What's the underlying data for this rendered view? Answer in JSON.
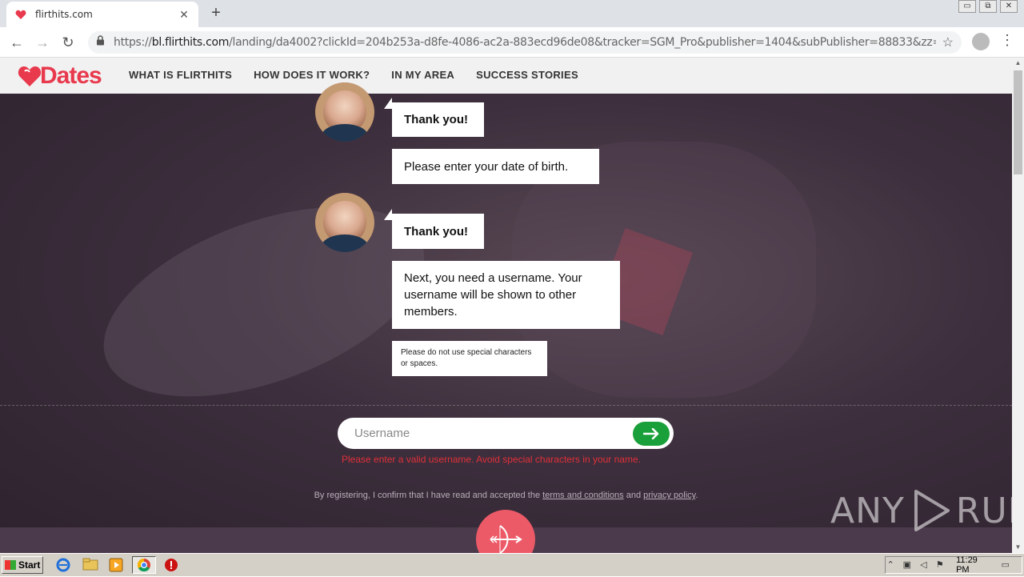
{
  "browser": {
    "tab_title": "flirthits.com",
    "new_tab_symbol": "+",
    "close_tab_symbol": "✕",
    "url_prefix": "https://",
    "url_host": "bl.flirthits.com",
    "url_rest": "/landing/da4002?clickId=204b253a-d8fe-4086-ac2a-883ecd96de08&tracker=SGM_Pro&publisher=1404&subPublisher=88833&zz=true&hit_id...",
    "back": "←",
    "forward": "→",
    "reload": "↻",
    "star": "☆",
    "menu": "⋮",
    "win_min": "▭",
    "win_max": "⧉",
    "win_close": "✕"
  },
  "site": {
    "logo_text": "Dates",
    "brand_color": "#e8394d",
    "nav": [
      {
        "label": "WHAT IS FLIRTHITS"
      },
      {
        "label": "HOW DOES IT WORK?"
      },
      {
        "label": "IN MY AREA"
      },
      {
        "label": "SUCCESS STORIES"
      }
    ]
  },
  "chat": {
    "messages": [
      {
        "text": "Thank you!"
      },
      {
        "text": "Please enter your date of birth."
      },
      {
        "text": "Thank you!"
      },
      {
        "text": "Next, you need a username. Your username will be shown to other members."
      }
    ],
    "hint": "Please do not use special characters or spaces."
  },
  "form": {
    "username_placeholder": "Username",
    "username_value": "",
    "error": "Please enter a valid username. Avoid special characters in your name.",
    "submit_color": "#1aa03a",
    "terms_prefix": "By registering, I confirm that I have read and accepted the ",
    "terms_link": "terms and conditions",
    "terms_and": " and ",
    "privacy_link": "privacy policy",
    "terms_suffix": "."
  },
  "watermark": {
    "left": "ANY",
    "right": "RUN"
  },
  "taskbar": {
    "start_label": "Start",
    "time": "11:29 PM"
  }
}
